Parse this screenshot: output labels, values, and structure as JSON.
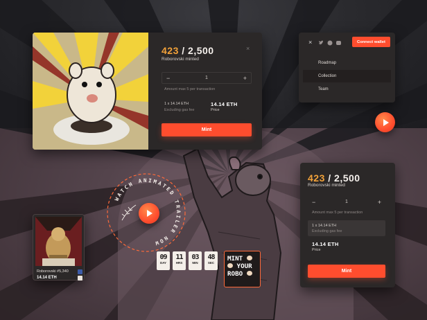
{
  "mint_card": {
    "minted_count": "423",
    "separator_total": " / 2,500",
    "subtitle": "Roborovski minted",
    "close_symbol": "×",
    "quantity": "1",
    "minus": "−",
    "plus": "+",
    "amount_hint": "Amount max 5 per transaction",
    "line_item": "1 x 14.14 ETH",
    "gas_note": "Excluding gas fee",
    "total_eth": "14.14 ETH",
    "price_label": "Price",
    "mint_button": "Mint"
  },
  "nav_card": {
    "close_symbol": "×",
    "connect_button": "Connect wallet",
    "social_icons": [
      "twitter-icon",
      "telegram-icon",
      "discord-icon"
    ],
    "menu": [
      "Roadmap",
      "Collection",
      "Team"
    ]
  },
  "mint_card_2": {
    "minted_count": "423",
    "separator_total": " / 2,500",
    "subtitle": "Roborovski minted",
    "quantity": "1",
    "minus": "−",
    "plus": "+",
    "amount_hint": "Amount max 5 per transaction",
    "line_item": "1 x 14.14 ETH",
    "gas_note": "Excluding gas fee",
    "total_eth": "14.14 ETH",
    "price_label": "Price",
    "mint_button": "Mint"
  },
  "trailer_badge": {
    "ring_text": "WATCH ANIMATED TRAILER NOW"
  },
  "nft_card": {
    "name": "Roborovski #5,340",
    "price": "14.14 ETH"
  },
  "countdown": [
    {
      "value": "09",
      "label": "DAY"
    },
    {
      "value": "11",
      "label": "HRS"
    },
    {
      "value": "03",
      "label": "MIN"
    },
    {
      "value": "48",
      "label": "SEC"
    }
  ],
  "mint_robo_sticker": {
    "line1": "MINT",
    "line2": "YOUR",
    "line3": "ROBO"
  },
  "colors": {
    "accent": "#ff4d2e",
    "highlight": "#f2a23a",
    "card_bg": "#2b2828"
  }
}
